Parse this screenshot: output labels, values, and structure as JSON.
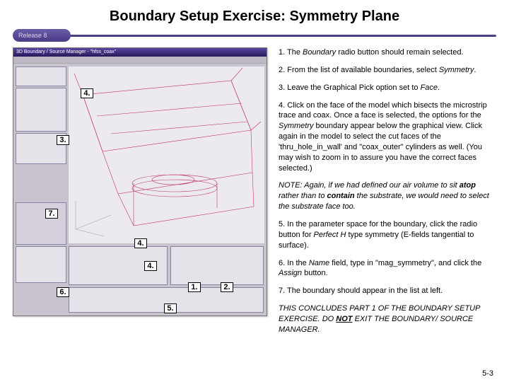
{
  "title": "Boundary Setup Exercise: Symmetry Plane",
  "release": "Release 8",
  "shot": {
    "titlebar": "3D Boundary / Source Manager - \"hfss_coax\""
  },
  "callouts": {
    "c1": "1.",
    "c2": "2.",
    "c3": "3.",
    "c4a": "4.",
    "c4b": "4.",
    "c4c": "4.",
    "c5": "5.",
    "c6": "6.",
    "c7": "7."
  },
  "steps": {
    "s1_a": "1.  The ",
    "s1_b": "Boundary",
    "s1_c": " radio button should remain selected.",
    "s2_a": "2.  From the list of available boundaries, select ",
    "s2_b": "Symmetry",
    "s2_c": ".",
    "s3_a": "3.  Leave the Graphical Pick option set to ",
    "s3_b": "Face",
    "s3_c": ".",
    "s4_a": "4.  Click on the face of the model which bisects the microstrip trace and coax.  Once a face is selected, the options for the ",
    "s4_b": "Symmetry",
    "s4_c": " boundary appear below the graphical view.  Click again in the model to select the cut faces of the 'thru_hole_in_wall' and \"coax_outer\" cylinders as well.  (You may wish to zoom in to assure you have the correct faces selected.)",
    "note_a": "NOTE:  Again, if we had defined our air volume to sit ",
    "note_b": "atop",
    "note_c": " rather than to ",
    "note_d": "contain",
    "note_e": " the substrate, we would need to select the substrate face too.",
    "s5_a": "5.  In the parameter space for the boundary, click the radio button for ",
    "s5_b": "Perfect H",
    "s5_c": " type symmetry (E-fields tangential to surface).",
    "s6_a": "6.  In the ",
    "s6_b": "Name",
    "s6_c": " field, type in \"mag_symmetry\", and click the ",
    "s6_d": "Assign",
    "s6_e": " button.",
    "s7": "7. The boundary should appear in the list at left.",
    "closing_a": "THIS CONCLUDES PART 1 OF THE BOUNDARY SETUP EXERCISE.  DO ",
    "closing_b": "NOT",
    "closing_c": " EXIT THE BOUNDARY/ SOURCE MANAGER."
  },
  "pagenum": "5-3"
}
